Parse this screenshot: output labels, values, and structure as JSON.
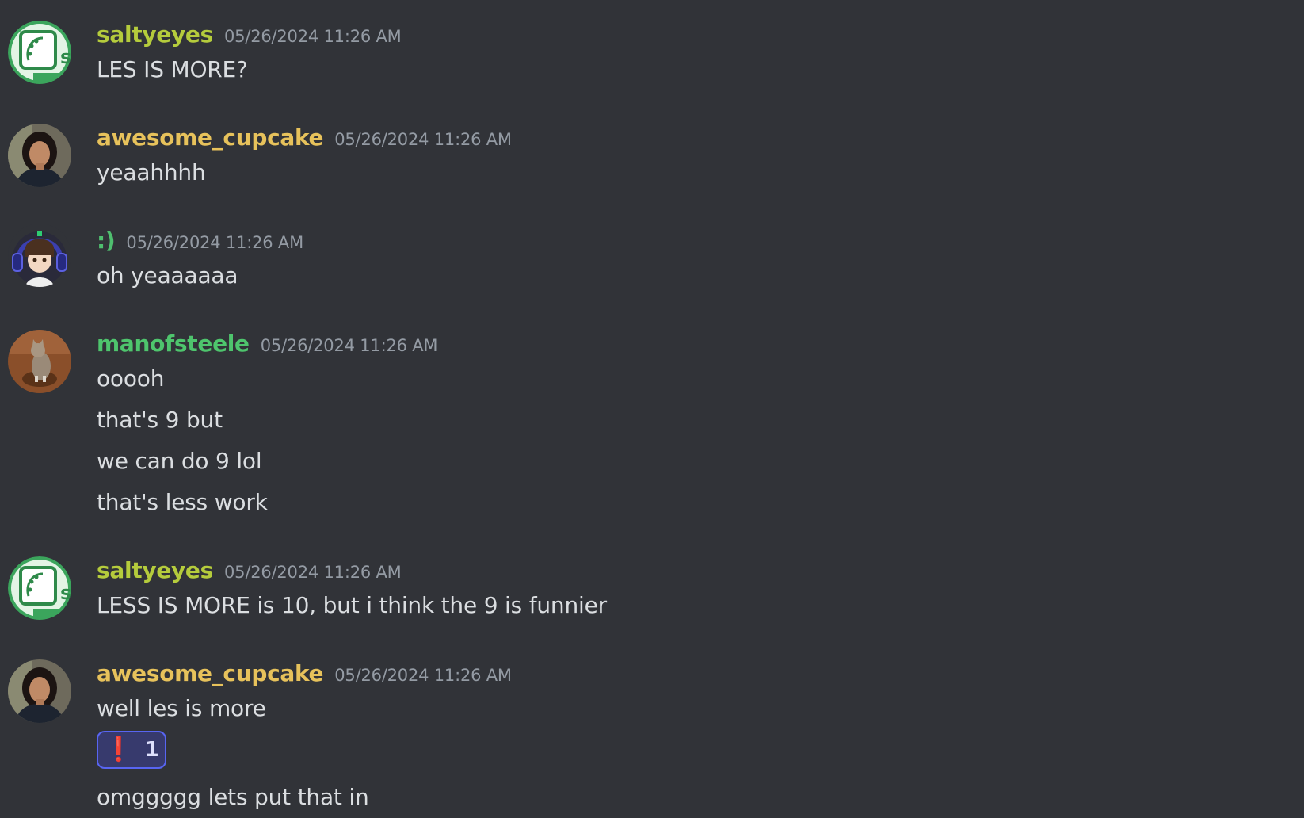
{
  "colors": {
    "background": "#313338",
    "text": "#dbdee1",
    "timestamp": "#949ba4",
    "saltyeyes": "#b5cc3c",
    "awesome_cupcake": "#e7c25b",
    "smiley": "#4fbf6f",
    "manofsteele": "#4ec56d",
    "reaction_border": "#5865f2",
    "reaction_bg": "#373a6d"
  },
  "messages": [
    {
      "author": "saltyeyes",
      "avatar_icon": "green-plant-logo-icon",
      "timestamp": "05/26/2024 11:26 AM",
      "lines": [
        "LES IS MORE?"
      ]
    },
    {
      "author": "awesome_cupcake",
      "avatar_icon": "woman-portrait-avatar",
      "timestamp": "05/26/2024 11:26 AM",
      "lines": [
        "yeaahhhh"
      ]
    },
    {
      "author": ":)",
      "avatar_icon": "anime-headphones-avatar",
      "timestamp": "05/26/2024 11:26 AM",
      "lines": [
        "oh yeaaaaaa"
      ]
    },
    {
      "author": "manofsteele",
      "avatar_icon": "cat-photo-avatar",
      "timestamp": "05/26/2024 11:26 AM",
      "lines": [
        "ooooh",
        "that's 9 but",
        "we can do 9 lol",
        "that's less work"
      ]
    },
    {
      "author": "saltyeyes",
      "avatar_icon": "green-plant-logo-icon",
      "timestamp": "05/26/2024 11:26 AM",
      "lines": [
        "LESS IS MORE is 10, but i think the 9 is funnier"
      ]
    },
    {
      "author": "awesome_cupcake",
      "avatar_icon": "woman-portrait-avatar",
      "timestamp": "05/26/2024 11:26 AM",
      "lines": [
        "well les is more",
        "omggggg lets put that in"
      ],
      "reaction": {
        "emoji": "❗",
        "count": "1"
      }
    }
  ]
}
